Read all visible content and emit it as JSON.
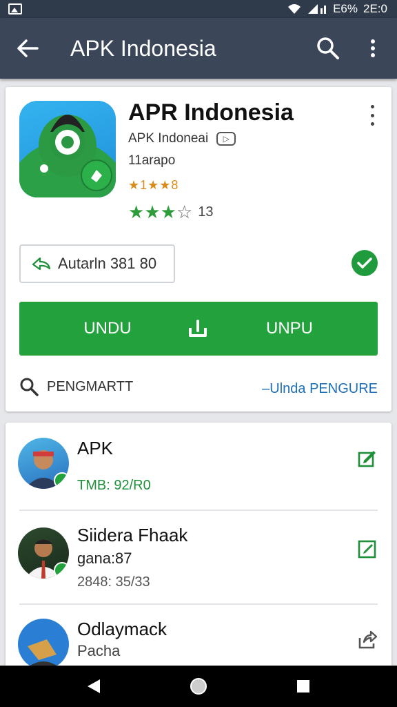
{
  "status_bar": {
    "battery": "E6%",
    "time": "2E:0"
  },
  "app_bar": {
    "title": "APK Indonesia"
  },
  "app_card": {
    "name": "APR Indonesia",
    "developer": "APK Indoneai",
    "category": "11arapo",
    "rating_small": "★1★★8",
    "rating_count": "13",
    "rating_stars_filled": 3,
    "rating_stars_total": 4,
    "auth_label": "Autarln 381 80",
    "download_left": "UNDU",
    "download_right": "UNPU",
    "search_label": "PENGMARTT",
    "link_label": "–Ulnda PENGURE"
  },
  "list": [
    {
      "title": "APK",
      "meta": "TMB: 92/R0"
    },
    {
      "title": "Siidera Fhaak",
      "subtitle": "gana:87",
      "meta": "2848: 35/33"
    },
    {
      "title": "Odlaymack",
      "subtitle": "Pacha"
    }
  ],
  "colors": {
    "status_bar": "#2f3a4a",
    "app_bar": "#3b4658",
    "accent_green": "#22a13c",
    "link_blue": "#1e6fb8",
    "star_orange": "#d98c1b"
  }
}
